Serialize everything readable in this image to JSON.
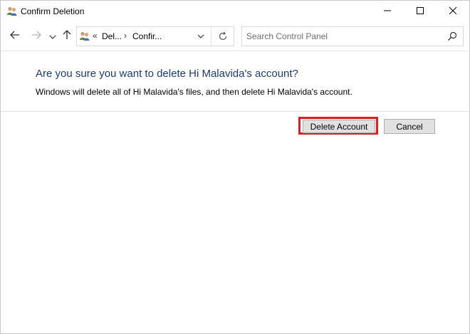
{
  "window": {
    "title": "Confirm Deletion"
  },
  "address_bar": {
    "separator": "«",
    "crumbs": [
      "Del...",
      "Confir..."
    ],
    "chevron": "›"
  },
  "search": {
    "placeholder": "Search Control Panel",
    "value": ""
  },
  "content": {
    "heading": "Are you sure you want to delete Hi Malavida's account?",
    "description": "Windows will delete all of Hi Malavida's files, and then delete Hi Malavida's account."
  },
  "buttons": {
    "delete_label": "Delete Account",
    "cancel_label": "Cancel"
  },
  "colors": {
    "heading": "#1e3a6e",
    "highlight": "#d4202b",
    "button_bg": "#e1e1e1"
  },
  "icons": {
    "title": "users-icon",
    "minimize": "minimize-icon",
    "maximize": "maximize-icon",
    "close": "close-icon",
    "back": "arrow-left-icon",
    "forward": "arrow-right-icon",
    "recent": "chevron-down-icon",
    "up": "arrow-up-icon",
    "refresh": "refresh-icon",
    "search": "search-icon"
  }
}
